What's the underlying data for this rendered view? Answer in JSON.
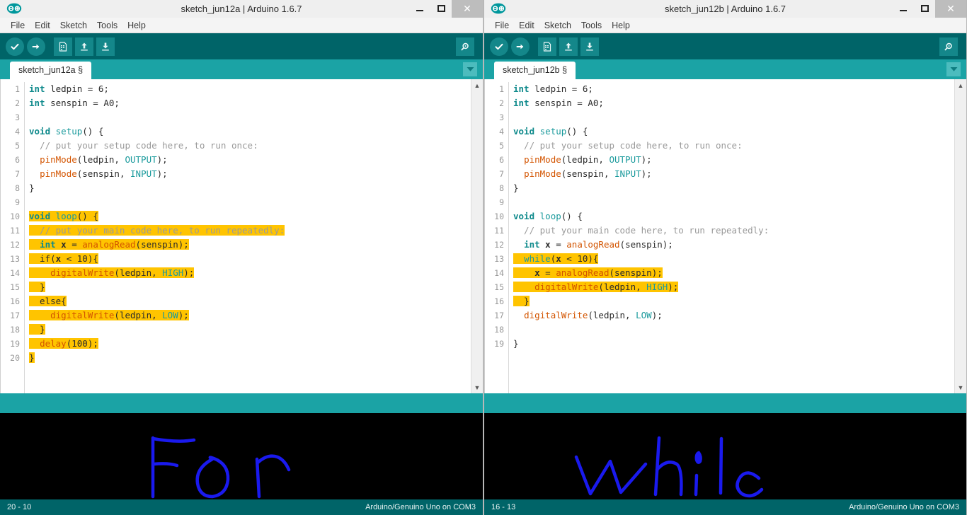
{
  "theme": {
    "toolbar_bg": "#006468",
    "tabstrip_bg": "#1ba3a5",
    "highlight": "#ffc400",
    "ink": "#1a1aee",
    "canvas_bg": "#000000",
    "keyword": "#0f8a8c",
    "function": "#d35400",
    "comment": "#9a9a9a",
    "constant": "#1a9a9c"
  },
  "windows": [
    {
      "id": "left",
      "title": "sketch_jun12a | Arduino 1.6.7",
      "logo_icon": "arduino-infinity-icon",
      "window_controls": {
        "minimize": "minimize-icon",
        "maximize": "maximize-icon",
        "close": "✕"
      },
      "menubar": [
        "File",
        "Edit",
        "Sketch",
        "Tools",
        "Help"
      ],
      "toolbar": [
        {
          "name": "verify-button",
          "icon": "check-icon",
          "label": "Verify"
        },
        {
          "name": "upload-button",
          "icon": "arrow-right-icon",
          "label": "Upload"
        },
        {
          "name": "new-button",
          "icon": "new-document-icon",
          "label": "New"
        },
        {
          "name": "open-button",
          "icon": "arrow-up-icon",
          "label": "Open"
        },
        {
          "name": "save-button",
          "icon": "arrow-down-icon",
          "label": "Save"
        },
        {
          "name": "serial-monitor-button",
          "icon": "magnifier-icon",
          "label": "Serial Monitor"
        }
      ],
      "tab": {
        "label": "sketch_jun12a §",
        "dropdown_icon": "chevron-down-icon"
      },
      "code": {
        "total_lines": 20,
        "lines": [
          {
            "n": 1,
            "hl": false,
            "tokens": [
              {
                "t": "kw",
                "s": "int"
              },
              {
                "t": "pln",
                "s": " ledpin = "
              },
              {
                "t": "num",
                "s": "6"
              },
              {
                "t": "pln",
                "s": ";"
              }
            ]
          },
          {
            "n": 2,
            "hl": false,
            "tokens": [
              {
                "t": "kw",
                "s": "int"
              },
              {
                "t": "pln",
                "s": " senspin = A0;"
              }
            ]
          },
          {
            "n": 3,
            "hl": false,
            "tokens": []
          },
          {
            "n": 4,
            "hl": false,
            "tokens": [
              {
                "t": "kw",
                "s": "void"
              },
              {
                "t": "pln",
                "s": " "
              },
              {
                "t": "cst",
                "s": "setup"
              },
              {
                "t": "pln",
                "s": "() {"
              }
            ]
          },
          {
            "n": 5,
            "hl": false,
            "tokens": [
              {
                "t": "cmt",
                "s": "  // put your setup code here, to run once:"
              }
            ]
          },
          {
            "n": 6,
            "hl": false,
            "tokens": [
              {
                "t": "pln",
                "s": "  "
              },
              {
                "t": "fn",
                "s": "pinMode"
              },
              {
                "t": "pln",
                "s": "(ledpin, "
              },
              {
                "t": "cst",
                "s": "OUTPUT"
              },
              {
                "t": "pln",
                "s": ");"
              }
            ]
          },
          {
            "n": 7,
            "hl": false,
            "tokens": [
              {
                "t": "pln",
                "s": "  "
              },
              {
                "t": "fn",
                "s": "pinMode"
              },
              {
                "t": "pln",
                "s": "(senspin, "
              },
              {
                "t": "cst",
                "s": "INPUT"
              },
              {
                "t": "pln",
                "s": ");"
              }
            ]
          },
          {
            "n": 8,
            "hl": false,
            "tokens": [
              {
                "t": "pln",
                "s": "}"
              }
            ]
          },
          {
            "n": 9,
            "hl": false,
            "tokens": []
          },
          {
            "n": 10,
            "hl": true,
            "tokens": [
              {
                "t": "kw",
                "s": "void"
              },
              {
                "t": "pln",
                "s": " "
              },
              {
                "t": "cst",
                "s": "loop"
              },
              {
                "t": "pln",
                "s": "() {"
              }
            ]
          },
          {
            "n": 11,
            "hl": true,
            "tokens": [
              {
                "t": "cmt",
                "s": "  // put your main code here, to run repeatedly:"
              }
            ]
          },
          {
            "n": 12,
            "hl": true,
            "tokens": [
              {
                "t": "pln",
                "s": "  "
              },
              {
                "t": "kw",
                "s": "int"
              },
              {
                "t": "pln",
                "s": " "
              },
              {
                "t": "var",
                "s": "x"
              },
              {
                "t": "pln",
                "s": " = "
              },
              {
                "t": "fn",
                "s": "analogRead"
              },
              {
                "t": "pln",
                "s": "(senspin);"
              }
            ]
          },
          {
            "n": 13,
            "hl": true,
            "tokens": [
              {
                "t": "pln",
                "s": "  if("
              },
              {
                "t": "var",
                "s": "x"
              },
              {
                "t": "pln",
                "s": " < "
              },
              {
                "t": "num",
                "s": "10"
              },
              {
                "t": "pln",
                "s": "){"
              }
            ]
          },
          {
            "n": 14,
            "hl": true,
            "tokens": [
              {
                "t": "pln",
                "s": "    "
              },
              {
                "t": "fn",
                "s": "digitalWrite"
              },
              {
                "t": "pln",
                "s": "(ledpin, "
              },
              {
                "t": "cst",
                "s": "HIGH"
              },
              {
                "t": "pln",
                "s": ");"
              }
            ]
          },
          {
            "n": 15,
            "hl": true,
            "tokens": [
              {
                "t": "pln",
                "s": "  }"
              }
            ]
          },
          {
            "n": 16,
            "hl": true,
            "tokens": [
              {
                "t": "pln",
                "s": "  else{"
              }
            ]
          },
          {
            "n": 17,
            "hl": true,
            "tokens": [
              {
                "t": "pln",
                "s": "    "
              },
              {
                "t": "fn",
                "s": "digitalWrite"
              },
              {
                "t": "pln",
                "s": "(ledpin, "
              },
              {
                "t": "cst",
                "s": "LOW"
              },
              {
                "t": "pln",
                "s": ");"
              }
            ]
          },
          {
            "n": 18,
            "hl": true,
            "tokens": [
              {
                "t": "pln",
                "s": "  }"
              }
            ]
          },
          {
            "n": 19,
            "hl": true,
            "tokens": [
              {
                "t": "pln",
                "s": "  "
              },
              {
                "t": "fn",
                "s": "delay"
              },
              {
                "t": "pln",
                "s": "("
              },
              {
                "t": "num",
                "s": "100"
              },
              {
                "t": "pln",
                "s": ");"
              }
            ]
          },
          {
            "n": 20,
            "hl": true,
            "tokens": [
              {
                "t": "pln",
                "s": "}"
              }
            ]
          }
        ]
      },
      "ink_word": "For",
      "status": {
        "position": "20 - 10",
        "board": "Arduino/Genuino Uno on COM3"
      }
    },
    {
      "id": "right",
      "title": "sketch_jun12b | Arduino 1.6.7",
      "logo_icon": "arduino-infinity-icon",
      "window_controls": {
        "minimize": "minimize-icon",
        "maximize": "maximize-icon",
        "close": "✕"
      },
      "menubar": [
        "File",
        "Edit",
        "Sketch",
        "Tools",
        "Help"
      ],
      "toolbar": [
        {
          "name": "verify-button",
          "icon": "check-icon",
          "label": "Verify"
        },
        {
          "name": "upload-button",
          "icon": "arrow-right-icon",
          "label": "Upload"
        },
        {
          "name": "new-button",
          "icon": "new-document-icon",
          "label": "New"
        },
        {
          "name": "open-button",
          "icon": "arrow-up-icon",
          "label": "Open"
        },
        {
          "name": "save-button",
          "icon": "arrow-down-icon",
          "label": "Save"
        },
        {
          "name": "serial-monitor-button",
          "icon": "magnifier-icon",
          "label": "Serial Monitor"
        }
      ],
      "tab": {
        "label": "sketch_jun12b §",
        "dropdown_icon": "chevron-down-icon"
      },
      "code": {
        "total_lines": 19,
        "lines": [
          {
            "n": 1,
            "hl": false,
            "tokens": [
              {
                "t": "kw",
                "s": "int"
              },
              {
                "t": "pln",
                "s": " ledpin = "
              },
              {
                "t": "num",
                "s": "6"
              },
              {
                "t": "pln",
                "s": ";"
              }
            ]
          },
          {
            "n": 2,
            "hl": false,
            "tokens": [
              {
                "t": "kw",
                "s": "int"
              },
              {
                "t": "pln",
                "s": " senspin = A0;"
              }
            ]
          },
          {
            "n": 3,
            "hl": false,
            "tokens": []
          },
          {
            "n": 4,
            "hl": false,
            "tokens": [
              {
                "t": "kw",
                "s": "void"
              },
              {
                "t": "pln",
                "s": " "
              },
              {
                "t": "cst",
                "s": "setup"
              },
              {
                "t": "pln",
                "s": "() {"
              }
            ]
          },
          {
            "n": 5,
            "hl": false,
            "tokens": [
              {
                "t": "cmt",
                "s": "  // put your setup code here, to run once:"
              }
            ]
          },
          {
            "n": 6,
            "hl": false,
            "tokens": [
              {
                "t": "pln",
                "s": "  "
              },
              {
                "t": "fn",
                "s": "pinMode"
              },
              {
                "t": "pln",
                "s": "(ledpin, "
              },
              {
                "t": "cst",
                "s": "OUTPUT"
              },
              {
                "t": "pln",
                "s": ");"
              }
            ]
          },
          {
            "n": 7,
            "hl": false,
            "tokens": [
              {
                "t": "pln",
                "s": "  "
              },
              {
                "t": "fn",
                "s": "pinMode"
              },
              {
                "t": "pln",
                "s": "(senspin, "
              },
              {
                "t": "cst",
                "s": "INPUT"
              },
              {
                "t": "pln",
                "s": ");"
              }
            ]
          },
          {
            "n": 8,
            "hl": false,
            "tokens": [
              {
                "t": "pln",
                "s": "}"
              }
            ]
          },
          {
            "n": 9,
            "hl": false,
            "tokens": []
          },
          {
            "n": 10,
            "hl": false,
            "tokens": [
              {
                "t": "kw",
                "s": "void"
              },
              {
                "t": "pln",
                "s": " "
              },
              {
                "t": "cst",
                "s": "loop"
              },
              {
                "t": "pln",
                "s": "() {"
              }
            ]
          },
          {
            "n": 11,
            "hl": false,
            "tokens": [
              {
                "t": "cmt",
                "s": "  // put your main code here, to run repeatedly:"
              }
            ]
          },
          {
            "n": 12,
            "hl": false,
            "tokens": [
              {
                "t": "pln",
                "s": "  "
              },
              {
                "t": "kw",
                "s": "int"
              },
              {
                "t": "pln",
                "s": " "
              },
              {
                "t": "var",
                "s": "x"
              },
              {
                "t": "pln",
                "s": " = "
              },
              {
                "t": "fn",
                "s": "analogRead"
              },
              {
                "t": "pln",
                "s": "(senspin);"
              }
            ]
          },
          {
            "n": 13,
            "hl": true,
            "tokens": [
              {
                "t": "pln",
                "s": "  "
              },
              {
                "t": "cst",
                "s": "while"
              },
              {
                "t": "pln",
                "s": "("
              },
              {
                "t": "var",
                "s": "x"
              },
              {
                "t": "pln",
                "s": " < "
              },
              {
                "t": "num",
                "s": "10"
              },
              {
                "t": "pln",
                "s": "){"
              }
            ]
          },
          {
            "n": 14,
            "hl": true,
            "tokens": [
              {
                "t": "pln",
                "s": "    "
              },
              {
                "t": "var",
                "s": "x"
              },
              {
                "t": "pln",
                "s": " = "
              },
              {
                "t": "fn",
                "s": "analogRead"
              },
              {
                "t": "pln",
                "s": "(senspin);"
              }
            ]
          },
          {
            "n": 15,
            "hl": true,
            "tokens": [
              {
                "t": "pln",
                "s": "    "
              },
              {
                "t": "fn",
                "s": "digitalWrite"
              },
              {
                "t": "pln",
                "s": "(ledpin, "
              },
              {
                "t": "cst",
                "s": "HIGH"
              },
              {
                "t": "pln",
                "s": ");"
              }
            ]
          },
          {
            "n": 16,
            "hl": true,
            "tokens": [
              {
                "t": "pln",
                "s": "  }"
              }
            ]
          },
          {
            "n": 17,
            "hl": false,
            "tokens": [
              {
                "t": "pln",
                "s": "  "
              },
              {
                "t": "fn",
                "s": "digitalWrite"
              },
              {
                "t": "pln",
                "s": "(ledpin, "
              },
              {
                "t": "cst",
                "s": "LOW"
              },
              {
                "t": "pln",
                "s": ");"
              }
            ]
          },
          {
            "n": 18,
            "hl": false,
            "tokens": []
          },
          {
            "n": 19,
            "hl": false,
            "tokens": [
              {
                "t": "pln",
                "s": "}"
              }
            ]
          }
        ]
      },
      "ink_word": "While",
      "status": {
        "position": "16 - 13",
        "board": "Arduino/Genuino Uno on COM3"
      }
    }
  ]
}
